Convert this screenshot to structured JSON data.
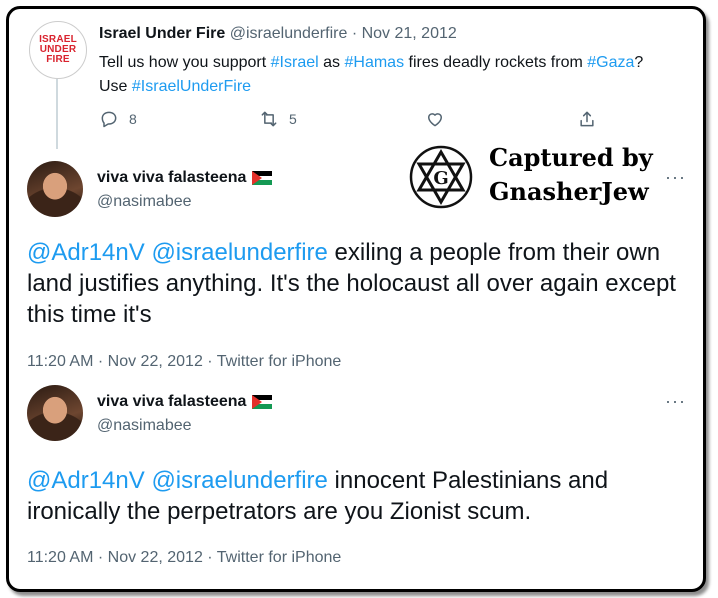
{
  "tweet1": {
    "avatar_text": [
      "ISRAEL",
      "UNDER",
      "FIRE"
    ],
    "name": "Israel Under Fire",
    "handle": "@israelunderfire",
    "sep": "·",
    "date": "Nov 21, 2012",
    "text": {
      "p1": "Tell us how you support ",
      "h1": "#Israel",
      "p2": " as ",
      "h2": "#Hamas",
      "p3": " fires deadly rockets from ",
      "h3": "#Gaza",
      "p4": "? Use ",
      "h4": "#IsraelUnderFire"
    },
    "reply_count": "8",
    "retweet_count": "5"
  },
  "watermark": {
    "line1": "Captured by",
    "line2": "GnasherJew",
    "star_letter": "G"
  },
  "tweet2": {
    "name": "viva viva falasteena",
    "handle": "@nasimabee",
    "more": "···",
    "mention1": "@Adr14nV",
    "mention2": "@israelunderfire",
    "body": " exiling a people from their own land justifies anything. It's the holocaust all over again except this time it's",
    "time": "11:20 AM",
    "date": "Nov 22, 2012",
    "source": "Twitter for iPhone",
    "sep": "·"
  },
  "tweet3": {
    "name": "viva viva falasteena",
    "handle": "@nasimabee",
    "more": "···",
    "mention1": "@Adr14nV",
    "mention2": "@israelunderfire",
    "body": " innocent Palestinians and ironically the perpetrators are you Zionist scum.",
    "time": "11:20 AM",
    "date": "Nov 22, 2012",
    "source": "Twitter for iPhone",
    "sep": "·"
  },
  "colors": {
    "link": "#1d9bf0",
    "muted": "#536471",
    "text": "#0f1419"
  },
  "icons": [
    "reply-icon",
    "retweet-icon",
    "like-icon",
    "share-icon",
    "palestine-flag-icon",
    "star-of-david-icon",
    "more-icon"
  ]
}
